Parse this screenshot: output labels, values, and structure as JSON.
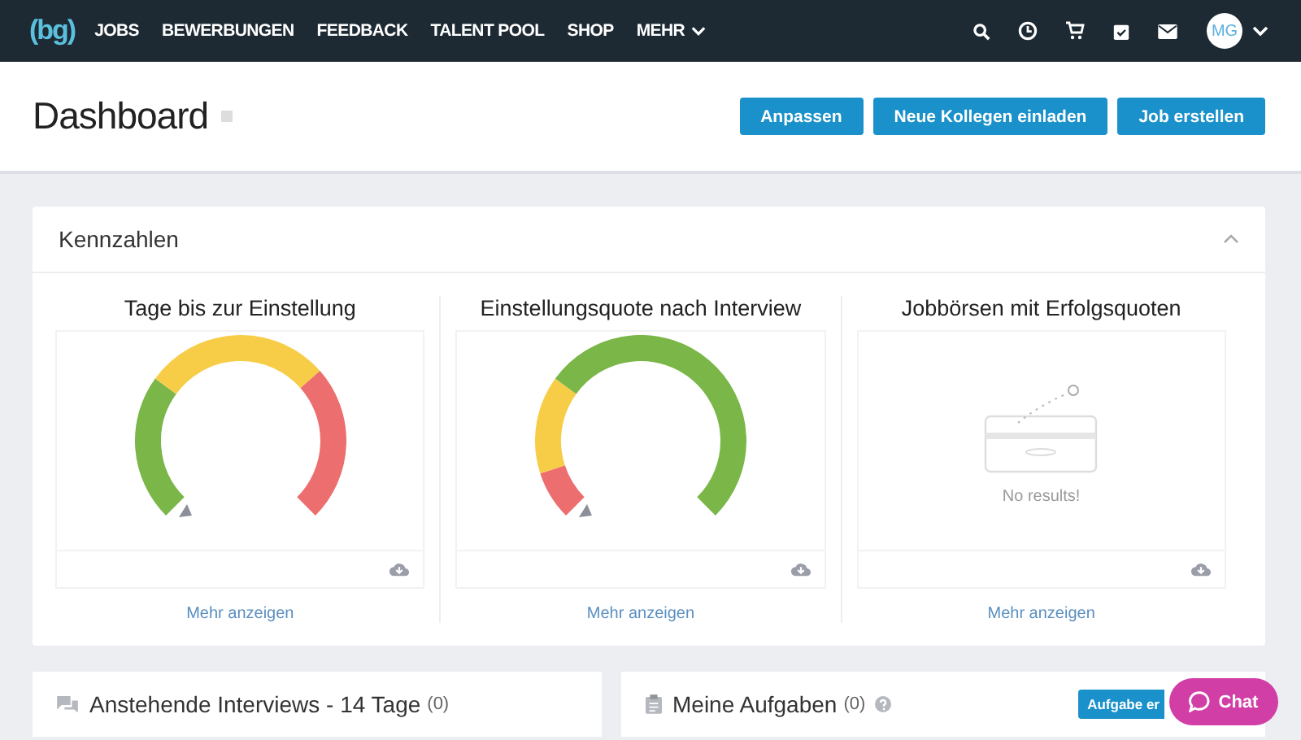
{
  "nav": {
    "logo": "(bg)",
    "items": [
      {
        "label": "JOBS",
        "dropdown": false
      },
      {
        "label": "BEWERBUNGEN",
        "dropdown": false
      },
      {
        "label": "FEEDBACK",
        "dropdown": false
      },
      {
        "label": "TALENT POOL",
        "dropdown": false
      },
      {
        "label": "SHOP",
        "dropdown": false
      },
      {
        "label": "MEHR",
        "dropdown": true
      }
    ],
    "avatar": "MG"
  },
  "header": {
    "title": "Dashboard",
    "buttons": [
      "Anpassen",
      "Neue Kollegen einladen",
      "Job erstellen"
    ]
  },
  "kennzahlen": {
    "title": "Kennzahlen",
    "expanded": true,
    "widgets": [
      {
        "title": "Tage bis zur Einstellung",
        "kind": "gauge",
        "link": "Mehr anzeigen"
      },
      {
        "title": "Einstellungsquote nach Interview",
        "kind": "gauge",
        "link": "Mehr anzeigen"
      },
      {
        "title": "Jobbörsen mit Erfolgsquoten",
        "kind": "empty",
        "message": "No results!",
        "link": "Mehr anzeigen"
      }
    ]
  },
  "bottom": [
    {
      "kind": "interviews",
      "title": "Anstehende Interviews - 14 Tage",
      "count": "(0)",
      "help": false
    },
    {
      "kind": "tasks",
      "title": "Meine Aufgaben",
      "count": "(0)",
      "help": true,
      "button": "Aufgabe er"
    }
  ],
  "chat": "Chat"
}
